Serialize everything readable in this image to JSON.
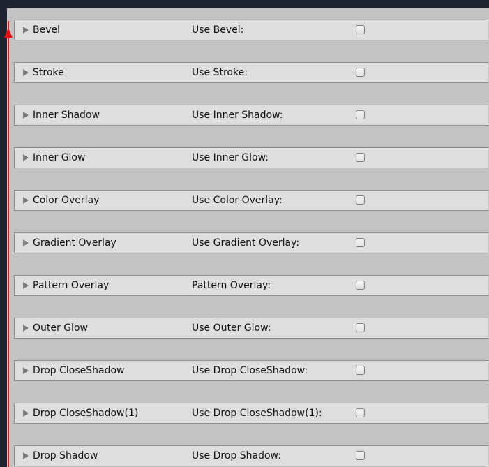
{
  "rows": [
    {
      "title": "Bevel",
      "use_label": "Use Bevel:"
    },
    {
      "title": "Stroke",
      "use_label": "Use Stroke:"
    },
    {
      "title": "Inner Shadow",
      "use_label": "Use Inner Shadow:"
    },
    {
      "title": "Inner Glow",
      "use_label": "Use Inner Glow:"
    },
    {
      "title": "Color Overlay",
      "use_label": "Use Color Overlay:"
    },
    {
      "title": "Gradient Overlay",
      "use_label": "Use Gradient Overlay:"
    },
    {
      "title": "Pattern Overlay",
      "use_label": "Pattern Overlay:"
    },
    {
      "title": "Outer Glow",
      "use_label": "Use Outer Glow:"
    },
    {
      "title": "Drop CloseShadow",
      "use_label": "Use Drop CloseShadow:"
    },
    {
      "title": "Drop CloseShadow(1)",
      "use_label": "Use Drop CloseShadow(1):"
    },
    {
      "title": "Drop Shadow",
      "use_label": "Use Drop Shadow:"
    }
  ],
  "arrow_indicator": {
    "direction": "up",
    "color": "#ee1111"
  }
}
